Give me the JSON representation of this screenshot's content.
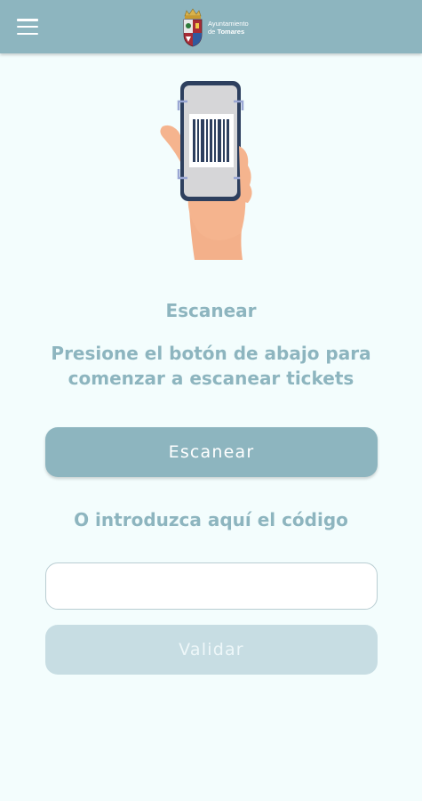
{
  "header": {
    "menu_icon": "hamburger-menu-icon",
    "logo_line1": "Ayuntamiento",
    "logo_line2_prefix": "de",
    "logo_line2_bold": "Tomares",
    "background_color": "#8db5bf"
  },
  "main": {
    "illustration": "hand-holding-phone-scanning-barcode",
    "title": "Escanear",
    "subtitle_line1": "Presione el botón de abajo para",
    "subtitle_line2": "comenzar a escanear tickets",
    "scan_button_label": "Escanear",
    "or_label": "O introduzca aquí el código",
    "code_input_value": "",
    "code_input_placeholder": "",
    "validate_button_label": "Validar",
    "accent_color": "#8db5bf",
    "disabled_button_color": "#c7dde3"
  }
}
